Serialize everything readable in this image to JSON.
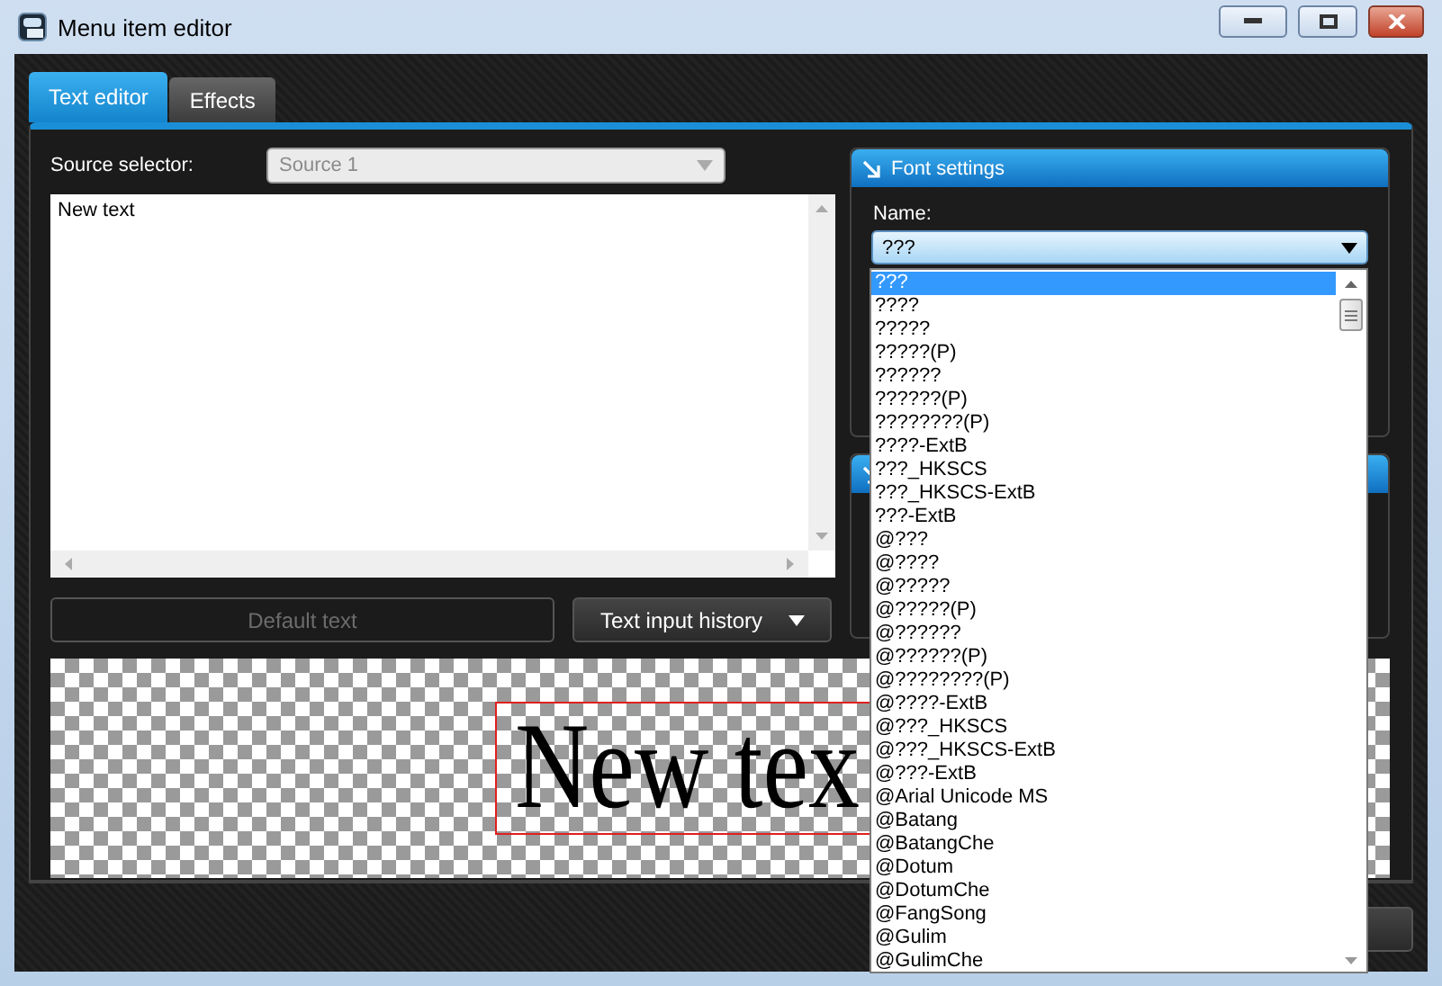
{
  "window": {
    "title": "Menu item editor"
  },
  "tabs": [
    {
      "label": "Text editor",
      "selected": true
    },
    {
      "label": "Effects",
      "selected": false
    }
  ],
  "source_selector": {
    "label": "Source selector:",
    "value": "Source 1",
    "disabled": true
  },
  "text_input": {
    "value": "New text"
  },
  "buttons": [
    {
      "label": "Default text",
      "disabled": true,
      "kind": "plain"
    },
    {
      "label": "Text input history",
      "disabled": false,
      "kind": "menu"
    }
  ],
  "preview": {
    "text": "New tex"
  },
  "font_settings": {
    "title": "Font settings",
    "name_label": "Name:",
    "name_value": "???",
    "options": [
      {
        "label": "???",
        "selected": true
      },
      {
        "label": "????",
        "selected": false
      },
      {
        "label": "?????",
        "selected": false
      },
      {
        "label": "?????(P)",
        "selected": false
      },
      {
        "label": "??????",
        "selected": false
      },
      {
        "label": "??????(P)",
        "selected": false
      },
      {
        "label": "????????(P)",
        "selected": false
      },
      {
        "label": "????-ExtB",
        "selected": false
      },
      {
        "label": "???_HKSCS",
        "selected": false
      },
      {
        "label": "???_HKSCS-ExtB",
        "selected": false
      },
      {
        "label": "???-ExtB",
        "selected": false
      },
      {
        "label": "@???",
        "selected": false
      },
      {
        "label": "@????",
        "selected": false
      },
      {
        "label": "@?????",
        "selected": false
      },
      {
        "label": "@?????(P)",
        "selected": false
      },
      {
        "label": "@??????",
        "selected": false
      },
      {
        "label": "@??????(P)",
        "selected": false
      },
      {
        "label": "@????????(P)",
        "selected": false
      },
      {
        "label": "@????-ExtB",
        "selected": false
      },
      {
        "label": "@???_HKSCS",
        "selected": false
      },
      {
        "label": "@???_HKSCS-ExtB",
        "selected": false
      },
      {
        "label": "@???-ExtB",
        "selected": false
      },
      {
        "label": "@Arial Unicode MS",
        "selected": false
      },
      {
        "label": "@Batang",
        "selected": false
      },
      {
        "label": "@BatangChe",
        "selected": false
      },
      {
        "label": "@Dotum",
        "selected": false
      },
      {
        "label": "@DotumChe",
        "selected": false
      },
      {
        "label": "@FangSong",
        "selected": false
      },
      {
        "label": "@Gulim",
        "selected": false
      },
      {
        "label": "@GulimChe",
        "selected": false
      }
    ]
  }
}
